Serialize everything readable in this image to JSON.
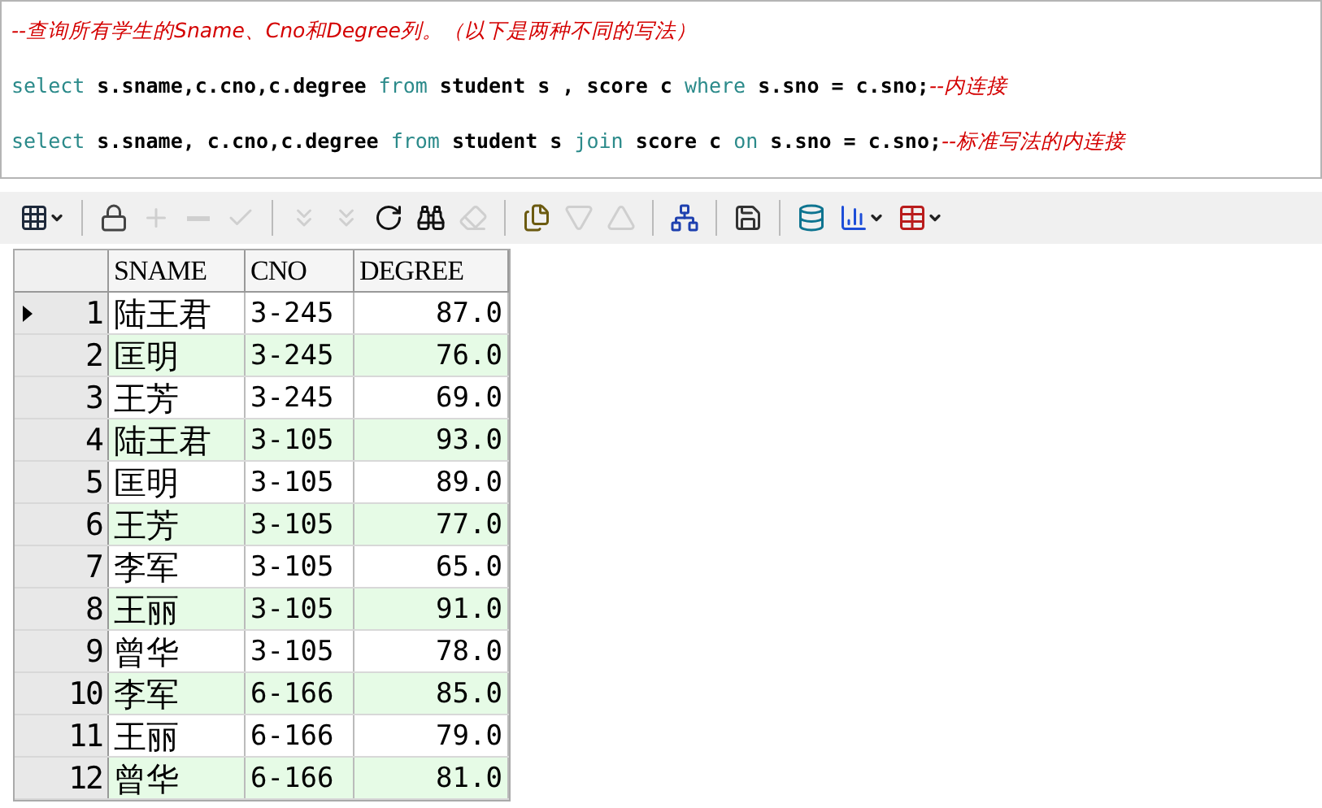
{
  "editor": {
    "lines": [
      [
        {
          "kind": "comment",
          "text": "--查询所有学生的Sname、Cno和Degree列。（以下是两种不同的写法）"
        }
      ],
      [
        {
          "kind": "keyword",
          "text": "select"
        },
        {
          "kind": "plain",
          "text": " s.sname,c.cno,c.degree "
        },
        {
          "kind": "keyword",
          "text": "from"
        },
        {
          "kind": "plain",
          "text": " student s , score c "
        },
        {
          "kind": "keyword",
          "text": "where"
        },
        {
          "kind": "plain",
          "text": " s.sno = c.sno;"
        },
        {
          "kind": "comment",
          "text": "--内连接"
        }
      ],
      [
        {
          "kind": "keyword",
          "text": "select"
        },
        {
          "kind": "plain",
          "text": " s.sname, c.cno,c.degree "
        },
        {
          "kind": "keyword",
          "text": "from"
        },
        {
          "kind": "plain",
          "text": " student s "
        },
        {
          "kind": "keyword",
          "text": "join"
        },
        {
          "kind": "plain",
          "text": " score c "
        },
        {
          "kind": "keyword",
          "text": "on"
        },
        {
          "kind": "plain",
          "text": " s.sno = c.sno;"
        },
        {
          "kind": "comment",
          "text": "--标准写法的内连接"
        }
      ]
    ]
  },
  "toolbar": [
    {
      "kind": "grid",
      "disabled": false,
      "dropdown": true
    },
    {
      "kind": "sep"
    },
    {
      "kind": "lock",
      "disabled": false
    },
    {
      "kind": "plus",
      "disabled": true
    },
    {
      "kind": "minus",
      "disabled": true
    },
    {
      "kind": "check",
      "disabled": true
    },
    {
      "kind": "sep"
    },
    {
      "kind": "down",
      "disabled": true
    },
    {
      "kind": "down2",
      "disabled": true
    },
    {
      "kind": "refresh",
      "disabled": false
    },
    {
      "kind": "binoculars",
      "disabled": false
    },
    {
      "kind": "eraser",
      "disabled": true
    },
    {
      "kind": "sep"
    },
    {
      "kind": "docs",
      "disabled": false
    },
    {
      "kind": "filter-down",
      "disabled": true
    },
    {
      "kind": "filter-up",
      "disabled": true
    },
    {
      "kind": "sep"
    },
    {
      "kind": "tree",
      "disabled": false
    },
    {
      "kind": "sep"
    },
    {
      "kind": "save",
      "disabled": false
    },
    {
      "kind": "sep"
    },
    {
      "kind": "db",
      "disabled": false
    },
    {
      "kind": "chart",
      "disabled": false,
      "dropdown": true
    },
    {
      "kind": "table",
      "disabled": false,
      "dropdown": true
    }
  ],
  "table": {
    "columns": [
      "SNAME",
      "CNO",
      "DEGREE"
    ],
    "rows": [
      {
        "num": "1",
        "selected": true,
        "cells": [
          "陆王君",
          "3-245",
          "87.0"
        ]
      },
      {
        "num": "2",
        "selected": false,
        "cells": [
          "匡明",
          "3-245",
          "76.0"
        ]
      },
      {
        "num": "3",
        "selected": false,
        "cells": [
          "王芳",
          "3-245",
          "69.0"
        ]
      },
      {
        "num": "4",
        "selected": false,
        "cells": [
          "陆王君",
          "3-105",
          "93.0"
        ]
      },
      {
        "num": "5",
        "selected": false,
        "cells": [
          "匡明",
          "3-105",
          "89.0"
        ]
      },
      {
        "num": "6",
        "selected": false,
        "cells": [
          "王芳",
          "3-105",
          "77.0"
        ]
      },
      {
        "num": "7",
        "selected": false,
        "cells": [
          "李军",
          "3-105",
          "65.0"
        ]
      },
      {
        "num": "8",
        "selected": false,
        "cells": [
          "王丽",
          "3-105",
          "91.0"
        ]
      },
      {
        "num": "9",
        "selected": false,
        "cells": [
          "曾华",
          "3-105",
          "78.0"
        ]
      },
      {
        "num": "10",
        "selected": false,
        "cells": [
          "李军",
          "6-166",
          "85.0"
        ]
      },
      {
        "num": "11",
        "selected": false,
        "cells": [
          "王丽",
          "6-166",
          "79.0"
        ]
      },
      {
        "num": "12",
        "selected": false,
        "cells": [
          "曾华",
          "6-166",
          "81.0"
        ]
      }
    ]
  }
}
